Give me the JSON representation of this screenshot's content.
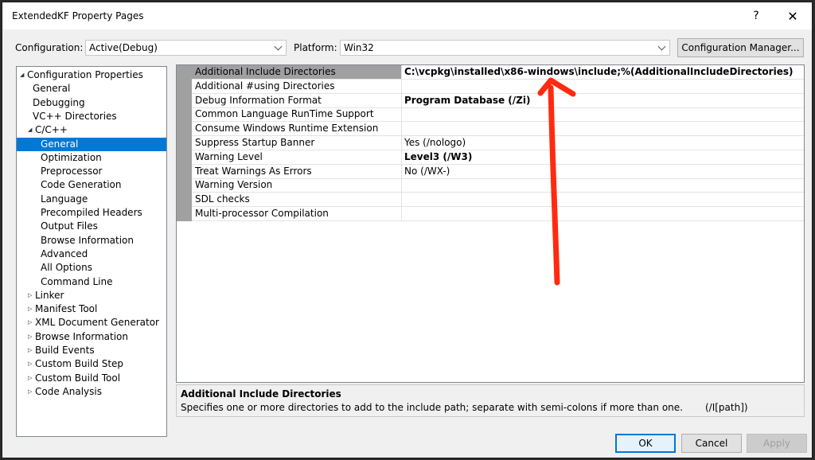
{
  "window": {
    "title": "ExtendedKF Property Pages",
    "help_glyph": "?",
    "close_glyph": "✕"
  },
  "toolbar": {
    "configuration_label": "Configuration:",
    "configuration_value": "Active(Debug)",
    "platform_label": "Platform:",
    "platform_value": "Win32",
    "config_manager_label": "Configuration Manager..."
  },
  "tree": {
    "items": [
      {
        "label": "Configuration Properties",
        "expander": "◢"
      },
      {
        "label": "General",
        "expander": ""
      },
      {
        "label": "Debugging",
        "expander": ""
      },
      {
        "label": "VC++ Directories",
        "expander": ""
      },
      {
        "label": "C/C++",
        "expander": "◢"
      },
      {
        "label": "General",
        "expander": ""
      },
      {
        "label": "Optimization",
        "expander": ""
      },
      {
        "label": "Preprocessor",
        "expander": ""
      },
      {
        "label": "Code Generation",
        "expander": ""
      },
      {
        "label": "Language",
        "expander": ""
      },
      {
        "label": "Precompiled Headers",
        "expander": ""
      },
      {
        "label": "Output Files",
        "expander": ""
      },
      {
        "label": "Browse Information",
        "expander": ""
      },
      {
        "label": "Advanced",
        "expander": ""
      },
      {
        "label": "All Options",
        "expander": ""
      },
      {
        "label": "Command Line",
        "expander": ""
      },
      {
        "label": "Linker",
        "expander": "▷"
      },
      {
        "label": "Manifest Tool",
        "expander": "▷"
      },
      {
        "label": "XML Document Generator",
        "expander": "▷"
      },
      {
        "label": "Browse Information",
        "expander": "▷"
      },
      {
        "label": "Build Events",
        "expander": "▷"
      },
      {
        "label": "Custom Build Step",
        "expander": "▷"
      },
      {
        "label": "Custom Build Tool",
        "expander": "▷"
      },
      {
        "label": "Code Analysis",
        "expander": "▷"
      }
    ]
  },
  "grid": {
    "rows": [
      {
        "name": "Additional Include Directories",
        "value": "C:\\vcpkg\\installed\\x86-windows\\include;%(AdditionalIncludeDirectories)"
      },
      {
        "name": "Additional #using Directories",
        "value": ""
      },
      {
        "name": "Debug Information Format",
        "value": "Program Database (/Zi)"
      },
      {
        "name": "Common Language RunTime Support",
        "value": ""
      },
      {
        "name": "Consume Windows Runtime Extension",
        "value": ""
      },
      {
        "name": "Suppress Startup Banner",
        "value": "Yes (/nologo)"
      },
      {
        "name": "Warning Level",
        "value": "Level3 (/W3)"
      },
      {
        "name": "Treat Warnings As Errors",
        "value": "No (/WX-)"
      },
      {
        "name": "Warning Version",
        "value": ""
      },
      {
        "name": "SDL checks",
        "value": ""
      },
      {
        "name": "Multi-processor Compilation",
        "value": ""
      }
    ]
  },
  "description": {
    "title": "Additional Include Directories",
    "text": "Specifies one or more directories to add to the include path; separate with semi-colons if more than one.",
    "switch": "(/I[path])"
  },
  "buttons": {
    "ok": "OK",
    "cancel": "Cancel",
    "apply": "Apply"
  },
  "colors": {
    "selection": "#0078d7",
    "annotation_arrow": "#ff2a10"
  }
}
